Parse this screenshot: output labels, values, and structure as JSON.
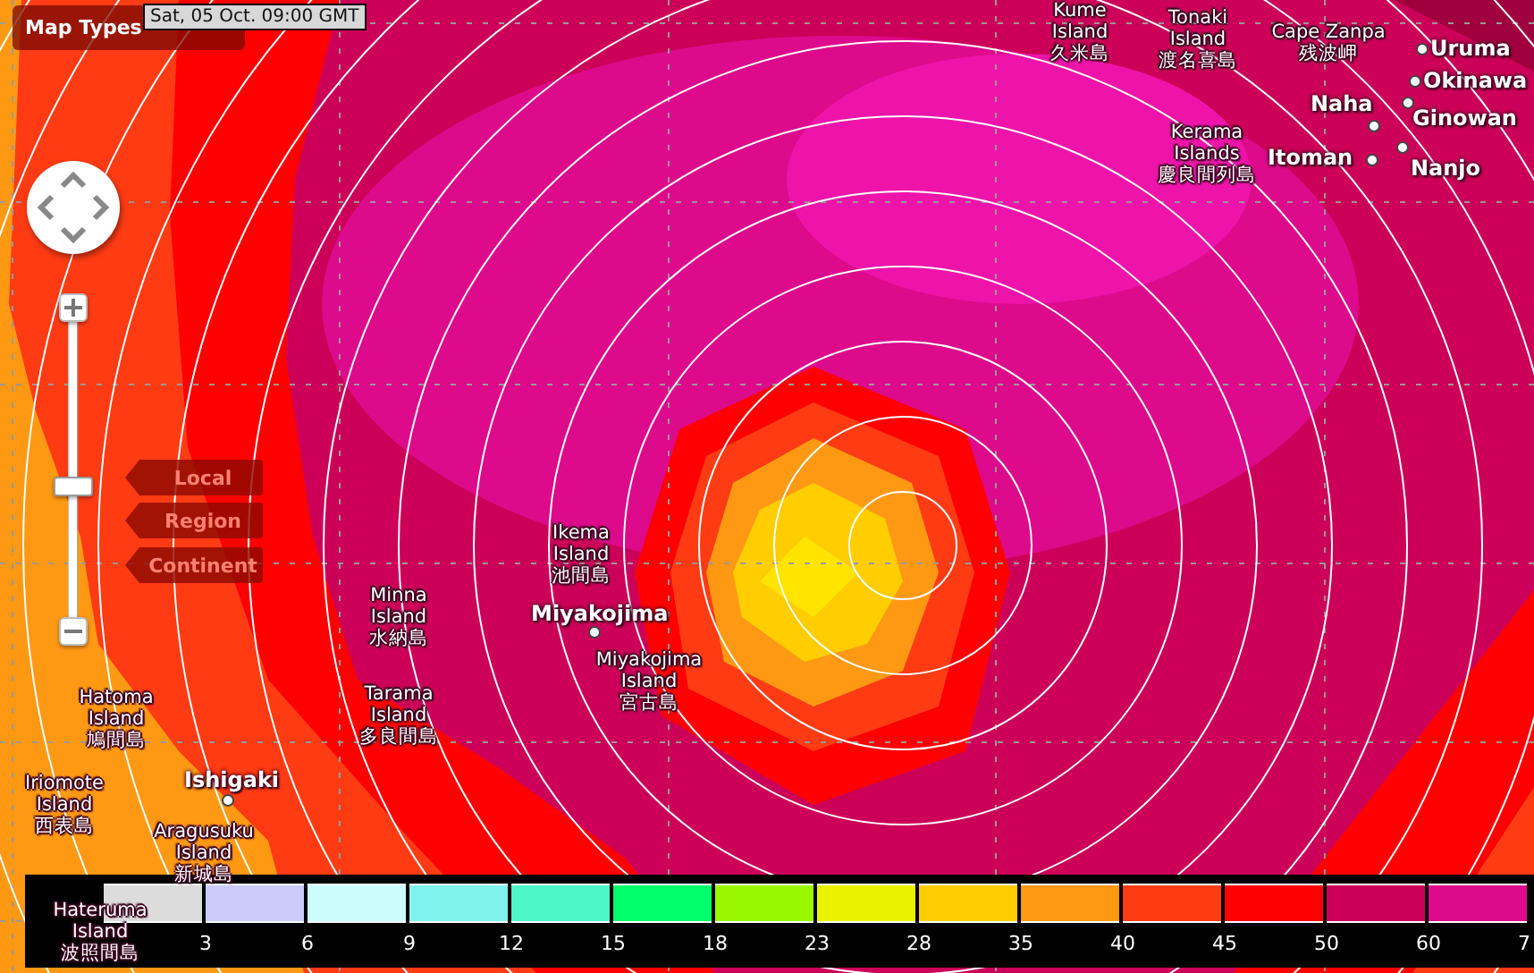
{
  "controls": {
    "map_types": "Map Types",
    "timestamp": "Sat, 05 Oct. 09:00 GMT",
    "zoom": {
      "level": 0.44
    },
    "scale_buttons": [
      "Local",
      "Region",
      "Continent"
    ]
  },
  "places": [
    {
      "kind": "island",
      "name": "Kume Island",
      "native": "久米島"
    },
    {
      "kind": "island",
      "name": "Tonaki Island",
      "native": "渡名喜島"
    },
    {
      "kind": "cape",
      "name": "Cape Zanpa",
      "native": "残波岬"
    },
    {
      "kind": "city",
      "name": "Uruma"
    },
    {
      "kind": "city",
      "name": "Okinawa"
    },
    {
      "kind": "city",
      "name": "Naha"
    },
    {
      "kind": "city",
      "name": "Ginowan"
    },
    {
      "kind": "island",
      "name": "Kerama Islands",
      "native": "慶良間列島"
    },
    {
      "kind": "city",
      "name": "Itoman"
    },
    {
      "kind": "city",
      "name": "Nanjo"
    },
    {
      "kind": "island",
      "name": "Ikema Island",
      "native": "池間島"
    },
    {
      "kind": "island",
      "name": "Minna Island",
      "native": "水納島"
    },
    {
      "kind": "city",
      "name": "Miyakojima"
    },
    {
      "kind": "island",
      "name": "Miyakojima Island",
      "native": "宮古島"
    },
    {
      "kind": "island",
      "name": "Hatoma Island",
      "native": "鳩間島"
    },
    {
      "kind": "island",
      "name": "Tarama Island",
      "native": "多良間島"
    },
    {
      "kind": "island",
      "name": "Iriomote Island",
      "native": "西表島"
    },
    {
      "kind": "city",
      "name": "Ishigaki"
    },
    {
      "kind": "island",
      "name": "Aragusuku Island",
      "native": "新城島"
    },
    {
      "kind": "island",
      "name": "Hateruma Island",
      "native": "波照間島"
    }
  ],
  "legend": [
    {
      "color": "#dcdcdc",
      "label": "3"
    },
    {
      "color": "#ccccfa",
      "label": "6"
    },
    {
      "color": "#ccfdfd",
      "label": "9"
    },
    {
      "color": "#80f2ee",
      "label": "12"
    },
    {
      "color": "#4cf7c8",
      "label": "15"
    },
    {
      "color": "#00ff6a",
      "label": "18"
    },
    {
      "color": "#99f800",
      "label": "23"
    },
    {
      "color": "#ebf200",
      "label": "28"
    },
    {
      "color": "#ffcd00",
      "label": "35"
    },
    {
      "color": "#ff9914",
      "label": "40"
    },
    {
      "color": "#ff3b14",
      "label": "45"
    },
    {
      "color": "#ff0000",
      "label": "50"
    },
    {
      "color": "#cc0058",
      "label": "60"
    },
    {
      "color": "#dd0a8c",
      "label": "7"
    }
  ]
}
